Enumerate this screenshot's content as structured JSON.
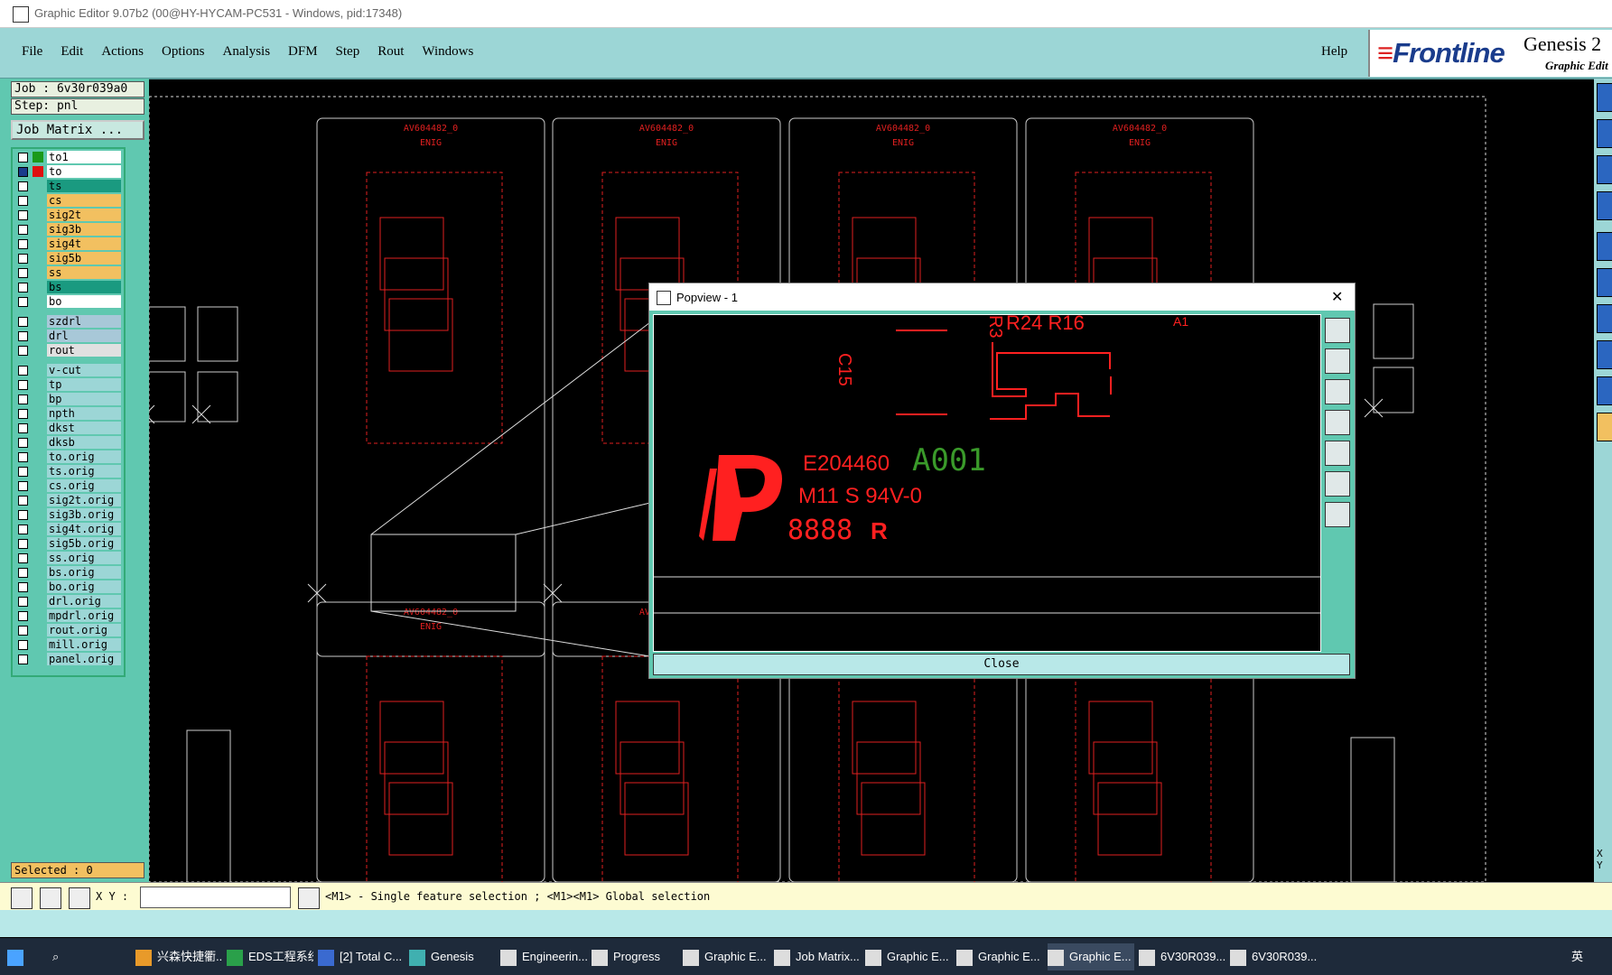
{
  "window": {
    "title": "Graphic Editor 9.07b2 (00@HY-HYCAM-PC531 - Windows, pid:17348)"
  },
  "menu": {
    "items": [
      "File",
      "Edit",
      "Actions",
      "Options",
      "Analysis",
      "DFM",
      "Step",
      "Rout",
      "Windows"
    ],
    "help": "Help"
  },
  "brand": {
    "logo": "Frontline",
    "product": "Genesis 2",
    "subtitle": "Graphic Edit"
  },
  "job": {
    "job": "Job : 6v30r039a0",
    "step": "Step: pnl",
    "matrix_button": "Job Matrix ..."
  },
  "layers": [
    {
      "name": "to1",
      "color": "#ffffff",
      "swatch": "#1a9a1a"
    },
    {
      "name": "to",
      "color": "#ffffff",
      "swatch": "#e01010",
      "active": true
    },
    {
      "name": "ts",
      "color": "#1a9a80",
      "swatch": ""
    },
    {
      "name": "cs",
      "color": "#f2c060",
      "swatch": ""
    },
    {
      "name": "sig2t",
      "color": "#f2c060",
      "swatch": ""
    },
    {
      "name": "sig3b",
      "color": "#f2c060",
      "swatch": ""
    },
    {
      "name": "sig4t",
      "color": "#f2c060",
      "swatch": ""
    },
    {
      "name": "sig5b",
      "color": "#f2c060",
      "swatch": ""
    },
    {
      "name": "ss",
      "color": "#f2c060",
      "swatch": ""
    },
    {
      "name": "bs",
      "color": "#1a9a80",
      "swatch": ""
    },
    {
      "name": "bo",
      "color": "#ffffff",
      "swatch": ""
    },
    {
      "name": "szdrl",
      "color": "#a8c8d8",
      "swatch": ""
    },
    {
      "name": "drl",
      "color": "#a8c8d8",
      "swatch": ""
    },
    {
      "name": "rout",
      "color": "#e0e0e0",
      "swatch": ""
    },
    {
      "name": "v-cut",
      "color": "#9cd6d6",
      "swatch": ""
    },
    {
      "name": "tp",
      "color": "#9cd6d6",
      "swatch": ""
    },
    {
      "name": "bp",
      "color": "#9cd6d6",
      "swatch": ""
    },
    {
      "name": "npth",
      "color": "#9cd6d6",
      "swatch": ""
    },
    {
      "name": "dkst",
      "color": "#9cd6d6",
      "swatch": ""
    },
    {
      "name": "dksb",
      "color": "#9cd6d6",
      "swatch": ""
    },
    {
      "name": "to.orig",
      "color": "#9cd6d6",
      "swatch": ""
    },
    {
      "name": "ts.orig",
      "color": "#9cd6d6",
      "swatch": ""
    },
    {
      "name": "cs.orig",
      "color": "#9cd6d6",
      "swatch": ""
    },
    {
      "name": "sig2t.orig",
      "color": "#9cd6d6",
      "swatch": ""
    },
    {
      "name": "sig3b.orig",
      "color": "#9cd6d6",
      "swatch": ""
    },
    {
      "name": "sig4t.orig",
      "color": "#9cd6d6",
      "swatch": ""
    },
    {
      "name": "sig5b.orig",
      "color": "#9cd6d6",
      "swatch": ""
    },
    {
      "name": "ss.orig",
      "color": "#9cd6d6",
      "swatch": ""
    },
    {
      "name": "bs.orig",
      "color": "#9cd6d6",
      "swatch": ""
    },
    {
      "name": "bo.orig",
      "color": "#9cd6d6",
      "swatch": ""
    },
    {
      "name": "drl.orig",
      "color": "#9cd6d6",
      "swatch": ""
    },
    {
      "name": "mpdrl.orig",
      "color": "#9cd6d6",
      "swatch": ""
    },
    {
      "name": "rout.orig",
      "color": "#9cd6d6",
      "swatch": ""
    },
    {
      "name": "mill.orig",
      "color": "#9cd6d6",
      "swatch": ""
    },
    {
      "name": "panel.orig",
      "color": "#9cd6d6",
      "swatch": ""
    }
  ],
  "selected": "Selected : 0",
  "status": {
    "xy_label": "X Y :",
    "xy_value": "",
    "message": "<M1> - Single feature selection ; <M1><M1> Global selection"
  },
  "canvas": {
    "board_label": "AV604482_0",
    "finish": "ENIG",
    "right_axis": "X\nY"
  },
  "popview": {
    "title": "Popview - 1",
    "close": "Close",
    "labels": {
      "r3": "R3",
      "r24": "R24 R16",
      "a1": "A1",
      "c15": "C15",
      "ul": "E204460",
      "code": "A001",
      "rating": "M11 S 94V-0",
      "date": "8888",
      "ur": "R"
    }
  },
  "taskbar": [
    {
      "label": "兴森快捷衢...",
      "icon": "orange"
    },
    {
      "label": "EDS工程系统",
      "icon": "green"
    },
    {
      "label": "[2] Total C...",
      "icon": "blue"
    },
    {
      "label": "Genesis",
      "icon": "teal"
    },
    {
      "label": "Engineerin...",
      "icon": "white"
    },
    {
      "label": "Progress",
      "icon": "white"
    },
    {
      "label": "Graphic E...",
      "icon": "white"
    },
    {
      "label": "Job Matrix...",
      "icon": "white"
    },
    {
      "label": "Graphic E...",
      "icon": "white"
    },
    {
      "label": "Graphic E...",
      "icon": "white"
    },
    {
      "label": "Graphic E...",
      "icon": "white"
    },
    {
      "label": "6V30R039...",
      "icon": "white"
    },
    {
      "label": "6V30R039...",
      "icon": "white"
    }
  ],
  "tray": {
    "ime": "英"
  }
}
